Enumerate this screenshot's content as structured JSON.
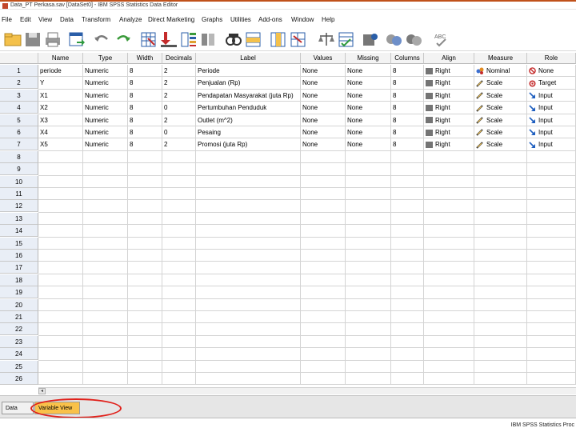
{
  "window": {
    "title": "Data_PT Perkasa.sav [DataSet0] - IBM SPSS Statistics Data Editor"
  },
  "menu": [
    "File",
    "Edit",
    "View",
    "Data",
    "Transform",
    "Analyze",
    "Direct Marketing",
    "Graphs",
    "Utilities",
    "Add-ons",
    "Window",
    "Help"
  ],
  "toolbar_icons": [
    "open-folder-icon",
    "save-icon",
    "print-icon",
    "dialog-recall-icon",
    "undo-icon",
    "redo-icon",
    "goto-case-icon",
    "goto-variable-icon",
    "variables-icon",
    "run-descriptives-icon",
    "find-icon",
    "insert-cases-icon",
    "insert-variable-icon",
    "split-file-icon",
    "weight-cases-icon",
    "select-cases-icon",
    "value-labels-icon",
    "use-sets-icon",
    "show-all-variables-icon",
    "spelling-icon"
  ],
  "columns": [
    "Name",
    "Type",
    "Width",
    "Decimals",
    "Label",
    "Values",
    "Missing",
    "Columns",
    "Align",
    "Measure",
    "Role"
  ],
  "variables": [
    {
      "name": "periode",
      "type": "Numeric",
      "width": "8",
      "decimals": "2",
      "label": "Periode",
      "values": "None",
      "missing": "None",
      "columns": "8",
      "align": "Right",
      "measure": "Nominal",
      "role": "None",
      "measure_icon": "nominal-icon",
      "role_icon": "none-role-icon"
    },
    {
      "name": "Y",
      "type": "Numeric",
      "width": "8",
      "decimals": "2",
      "label": "Penjualan (Rp)",
      "values": "None",
      "missing": "None",
      "columns": "8",
      "align": "Right",
      "measure": "Scale",
      "role": "Target",
      "measure_icon": "scale-icon",
      "role_icon": "target-icon"
    },
    {
      "name": "X1",
      "type": "Numeric",
      "width": "8",
      "decimals": "2",
      "label": "Pendapatan Masyarakat (juta Rp)",
      "values": "None",
      "missing": "None",
      "columns": "8",
      "align": "Right",
      "measure": "Scale",
      "role": "Input",
      "measure_icon": "scale-icon",
      "role_icon": "input-icon"
    },
    {
      "name": "X2",
      "type": "Numeric",
      "width": "8",
      "decimals": "0",
      "label": "Pertumbuhan Penduduk",
      "values": "None",
      "missing": "None",
      "columns": "8",
      "align": "Right",
      "measure": "Scale",
      "role": "Input",
      "measure_icon": "scale-icon",
      "role_icon": "input-icon"
    },
    {
      "name": "X3",
      "type": "Numeric",
      "width": "8",
      "decimals": "2",
      "label": "Outlet (m^2)",
      "values": "None",
      "missing": "None",
      "columns": "8",
      "align": "Right",
      "measure": "Scale",
      "role": "Input",
      "measure_icon": "scale-icon",
      "role_icon": "input-icon"
    },
    {
      "name": "X4",
      "type": "Numeric",
      "width": "8",
      "decimals": "0",
      "label": "Pesaing",
      "values": "None",
      "missing": "None",
      "columns": "8",
      "align": "Right",
      "measure": "Scale",
      "role": "Input",
      "measure_icon": "scale-icon",
      "role_icon": "input-icon"
    },
    {
      "name": "X5",
      "type": "Numeric",
      "width": "8",
      "decimals": "2",
      "label": "Promosi (juta Rp)",
      "values": "None",
      "missing": "None",
      "columns": "8",
      "align": "Right",
      "measure": "Scale",
      "role": "Input",
      "measure_icon": "scale-icon",
      "role_icon": "input-icon"
    }
  ],
  "row_numbers": [
    "1",
    "2",
    "3",
    "4",
    "5",
    "6",
    "7",
    "8",
    "9",
    "10",
    "11",
    "12",
    "13",
    "14",
    "15",
    "16",
    "17",
    "18",
    "19",
    "20",
    "21",
    "22",
    "23",
    "24",
    "25",
    "26"
  ],
  "tabs": {
    "data_view": "Data View",
    "variable_view": "Variable View"
  },
  "status": "IBM SPSS Statistics Proc",
  "colors": {
    "selected_tab": "#f9c14a",
    "highlight": "#e0201a",
    "row_header": "#e9eef6"
  }
}
